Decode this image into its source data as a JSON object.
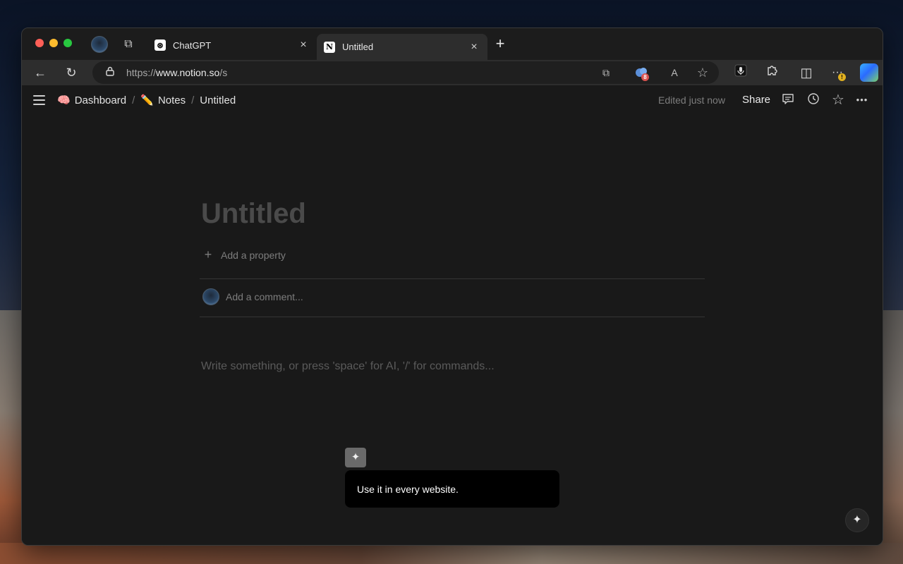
{
  "browser": {
    "tabs": [
      {
        "title": "ChatGPT",
        "favicon": "⊛",
        "active": false
      },
      {
        "title": "Untitled",
        "favicon": "N",
        "active": true
      }
    ],
    "new_tab_label": "+",
    "address": {
      "scheme": "https://",
      "host": "www.notion.so",
      "path": "/s"
    },
    "icons": {
      "back": "←",
      "reload": "↻",
      "lock": "🔒",
      "open_in_app": "⧉",
      "read_aloud": "A",
      "favorite": "☆",
      "extensions": "⧉",
      "split_screen": "◫",
      "more": "···",
      "close": "×",
      "collections": "⧉"
    },
    "extension_badge_count": "8",
    "more_badge": "!"
  },
  "notion": {
    "breadcrumb": [
      {
        "emoji": "🧠",
        "label": "Dashboard"
      },
      {
        "emoji": "✏️",
        "label": "Notes"
      },
      {
        "emoji": "",
        "label": "Untitled"
      }
    ],
    "breadcrumb_separator": "/",
    "edited_status": "Edited just now",
    "share_label": "Share",
    "page_title": "Untitled",
    "add_property_label": "Add a property",
    "add_property_icon": "+",
    "comment_placeholder": "Add a comment...",
    "body_placeholder": "Write something, or press 'space' for AI, '/' for commands...",
    "icons": {
      "comments": "▭",
      "history": "◷",
      "favorite": "☆",
      "more": "•••",
      "magic_wand": "✦",
      "ai_sparkle": "✦"
    }
  },
  "tooltip": {
    "text": "Use it in every website."
  }
}
